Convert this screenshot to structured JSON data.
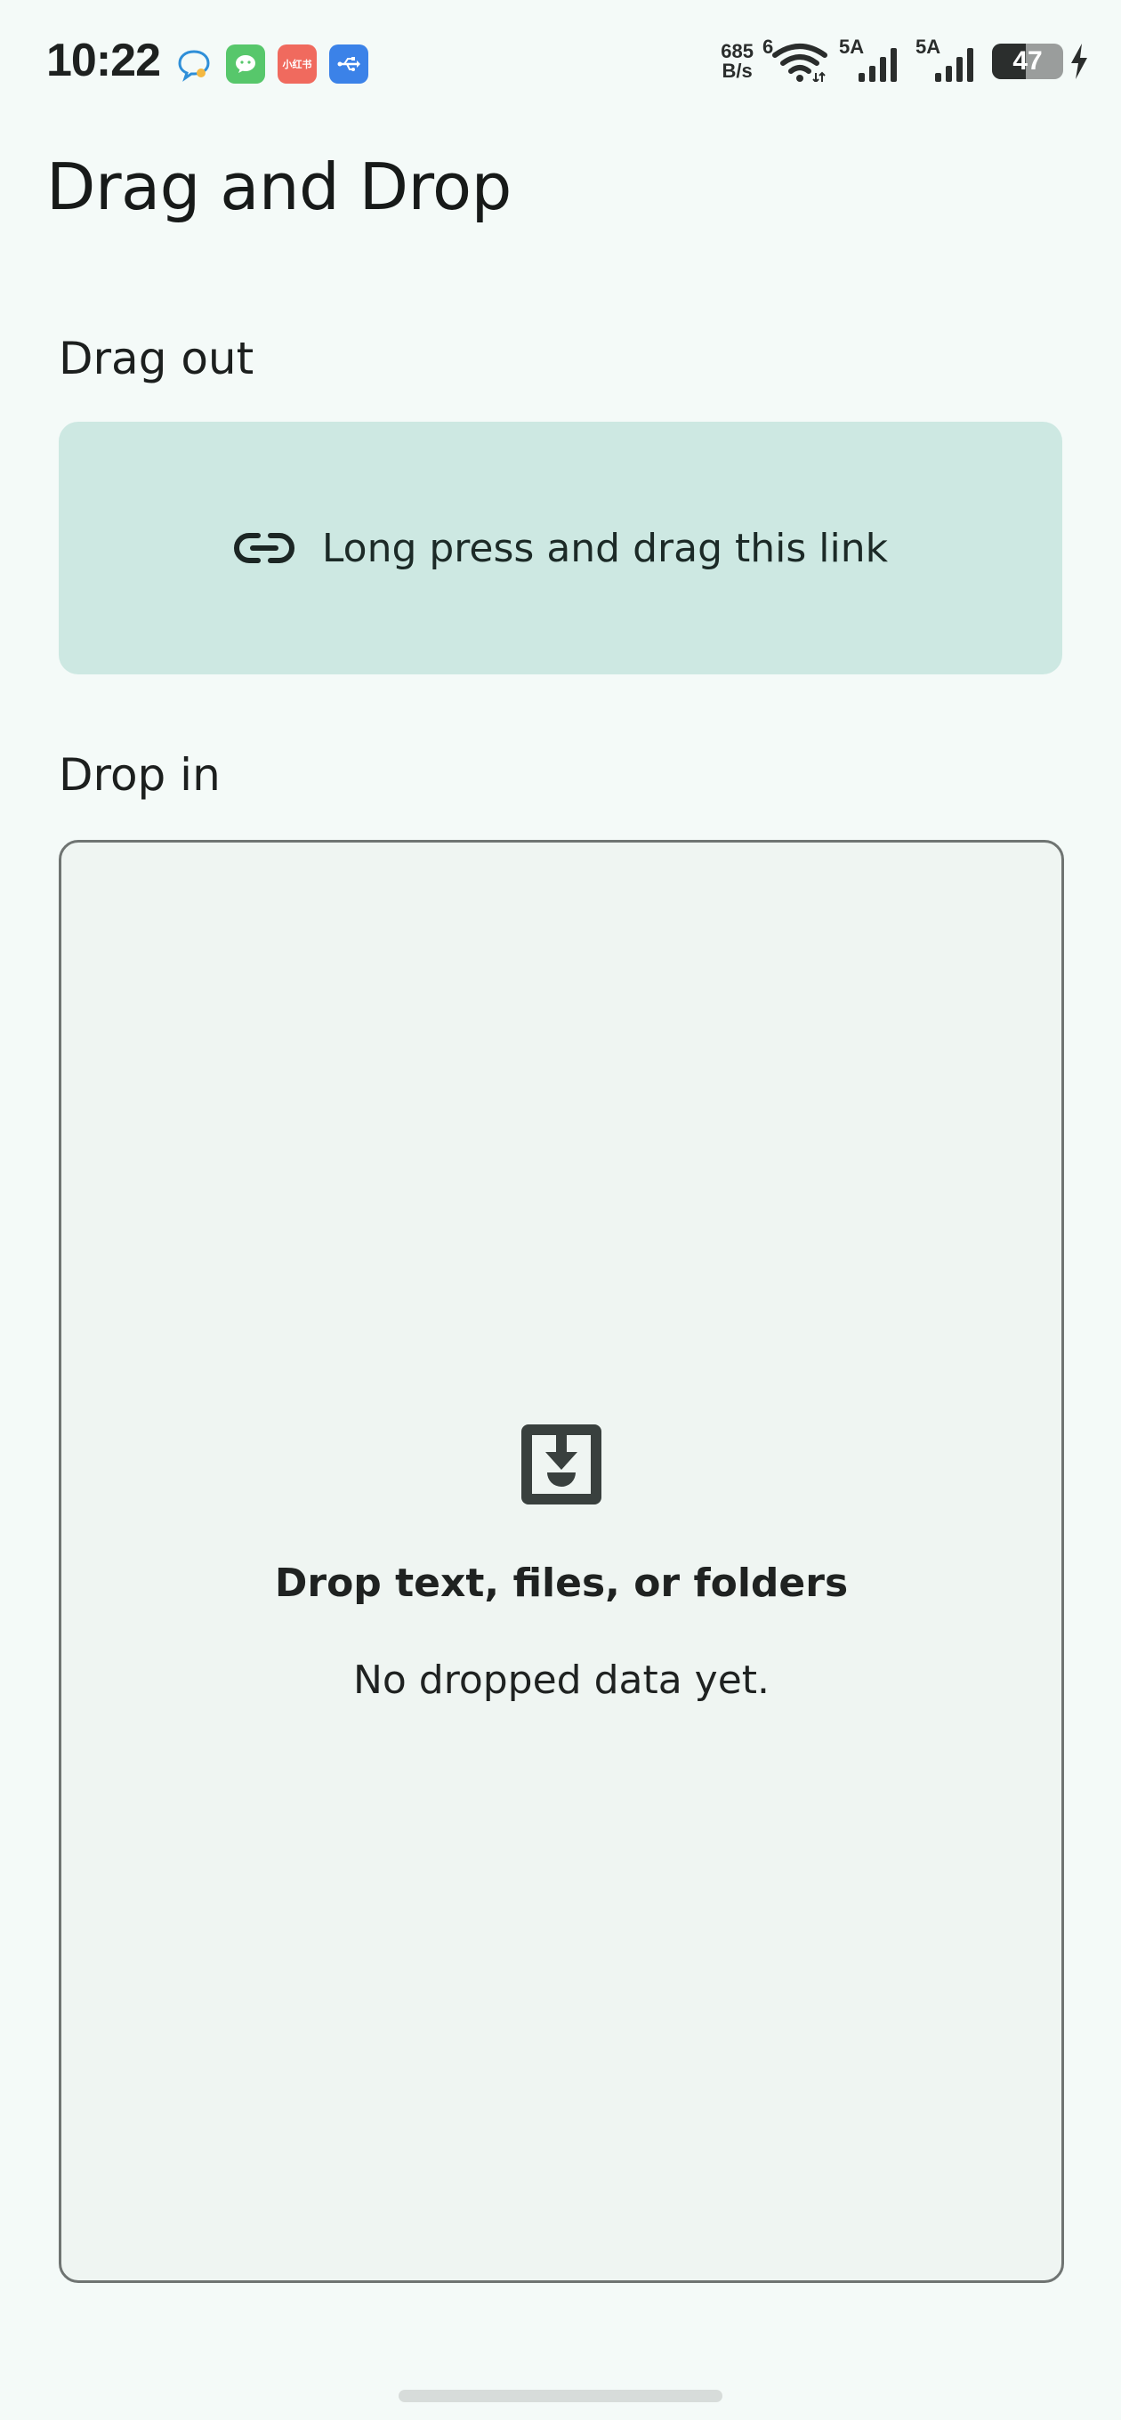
{
  "status_bar": {
    "time": "10:22",
    "net_speed_value": "685",
    "net_speed_unit": "B/s",
    "wifi_badge": "6",
    "sim1_label": "5A",
    "sim2_label": "5A",
    "battery_level": "47",
    "battery_fraction": 0.47,
    "notification_icons": [
      "chat-bubble-icon",
      "wechat-icon",
      "xiaohongshu-icon",
      "usb-icon"
    ],
    "xiaohongshu_text": "小红书"
  },
  "header": {
    "title": "Drag and Drop"
  },
  "drag_out": {
    "label": "Drag out",
    "card_text": "Long press and drag this link",
    "card_icon": "link-icon",
    "card_color": "#cde8e2"
  },
  "drop_in": {
    "label": "Drop in",
    "icon": "inbox-download-icon",
    "title": "Drop text, files, or folders",
    "status": "No dropped data yet.",
    "border_color": "#6f7472",
    "background_color": "#eff5f2"
  },
  "colors": {
    "background": "#f4faf8",
    "text_primary": "#1c1f1e"
  }
}
